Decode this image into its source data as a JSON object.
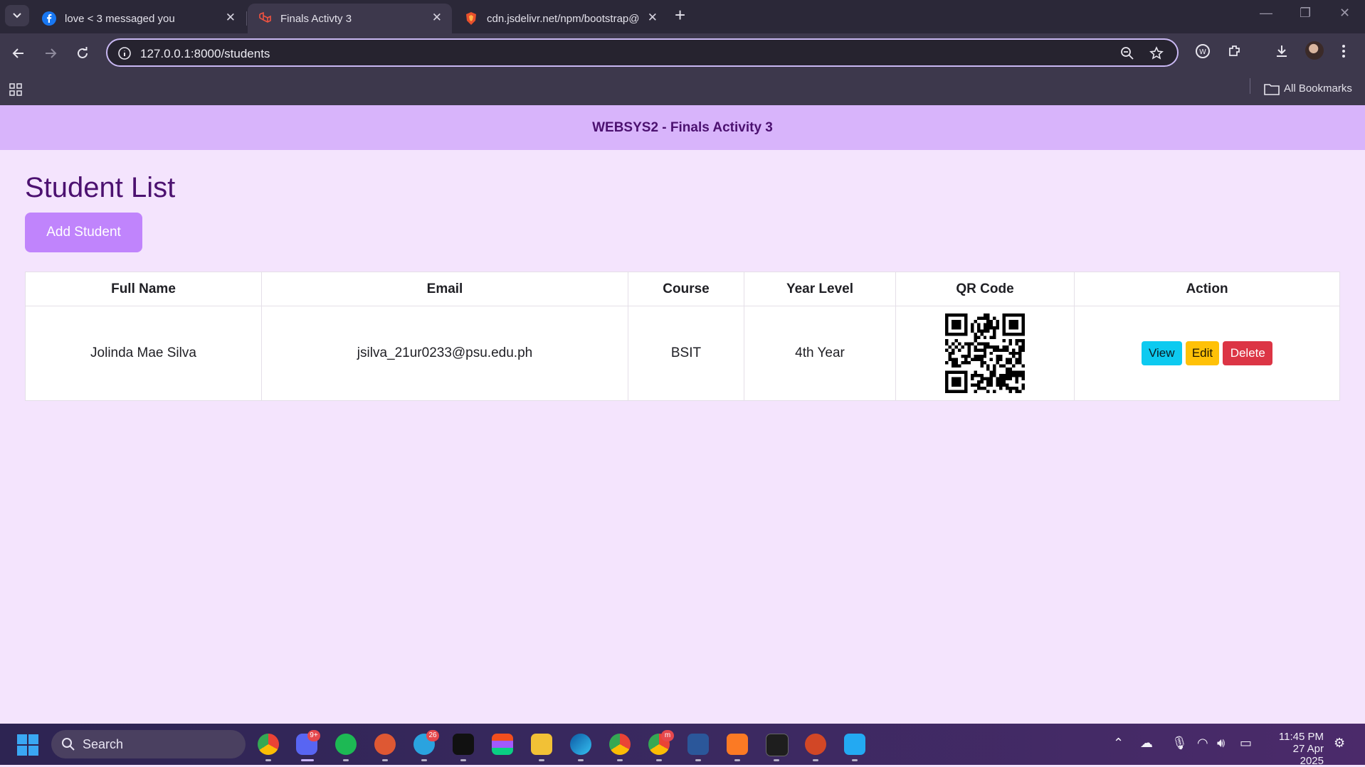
{
  "browser": {
    "tabs": [
      {
        "title": "love < 3 messaged you",
        "icon": "facebook-icon"
      },
      {
        "title": "Finals Activty 3",
        "icon": "laravel-icon"
      },
      {
        "title": "cdn.jsdelivr.net/npm/bootstrap@",
        "icon": "brave-shield-icon"
      }
    ],
    "active_tab_index": 1,
    "url": "127.0.0.1:8000/students",
    "bookmarks_label": "All Bookmarks"
  },
  "page": {
    "header_title": "WEBSYS2 - Finals Activity 3",
    "title": "Student List",
    "add_button": "Add Student",
    "table": {
      "columns": [
        "Full Name",
        "Email",
        "Course",
        "Year Level",
        "QR Code",
        "Action"
      ],
      "rows": [
        {
          "full_name": "Jolinda Mae Silva",
          "email": "jsilva_21ur0233@psu.edu.ph",
          "course": "BSIT",
          "year_level": "4th Year",
          "actions": {
            "view": "View",
            "edit": "Edit",
            "delete": "Delete"
          }
        }
      ]
    }
  },
  "taskbar": {
    "search_label": "Search",
    "badges": {
      "discord": "9+",
      "telegram": "26",
      "chrome_m": "m"
    },
    "time": "11:45 PM",
    "date": "27 Apr 2025"
  },
  "colors": {
    "page_bg": "#f4e4fd",
    "header_bg": "#d8b4fb",
    "title_text": "#4c1170",
    "add_button": "#c084fc",
    "view_button": "#0dcaf0",
    "edit_button": "#ffc107",
    "delete_button": "#dc3545"
  }
}
